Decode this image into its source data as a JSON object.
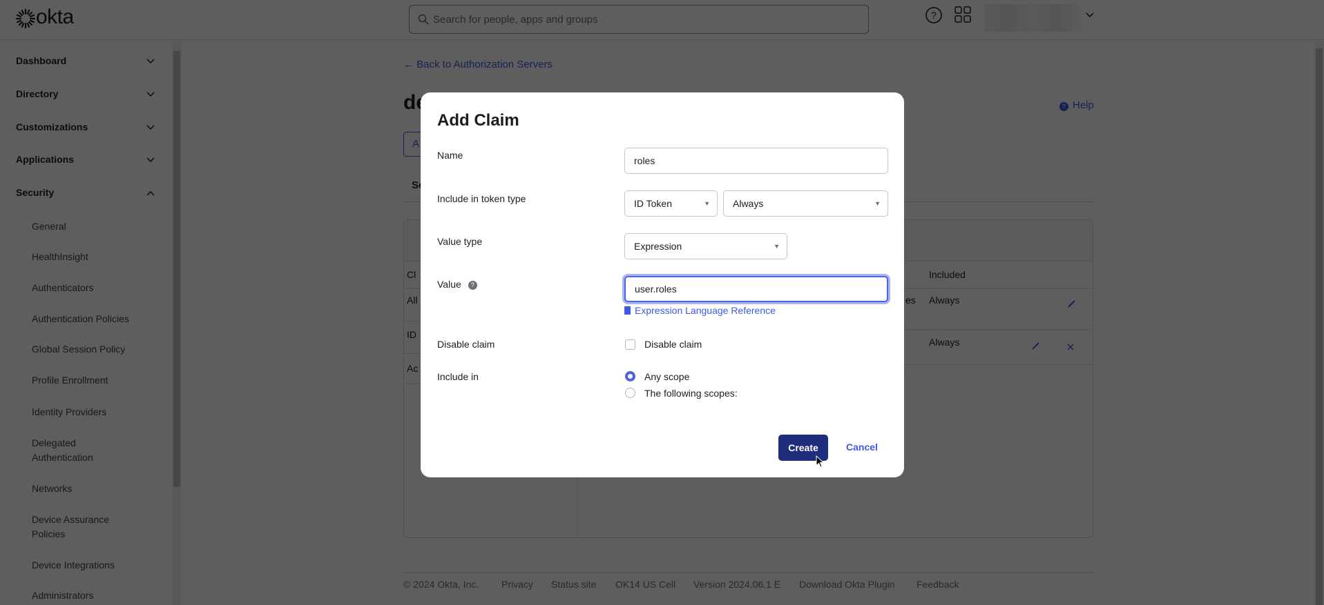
{
  "header": {
    "brand": "okta",
    "search_placeholder": "Search for people, apps and groups"
  },
  "sidebar": {
    "top_items": [
      {
        "label": "Dashboard",
        "expanded": false
      },
      {
        "label": "Directory",
        "expanded": false
      },
      {
        "label": "Customizations",
        "expanded": false
      },
      {
        "label": "Applications",
        "expanded": false
      },
      {
        "label": "Security",
        "expanded": true
      }
    ],
    "security_items": [
      "General",
      "HealthInsight",
      "Authenticators",
      "Authentication Policies",
      "Global Session Policy",
      "Profile Enrollment",
      "Identity Providers",
      "Delegated Authentication",
      "Networks",
      "Device Assurance Policies",
      "Device Integrations",
      "Administrators"
    ]
  },
  "page": {
    "back_link": "← Back to Authorization Servers",
    "title_fragment": "de",
    "help": "Help",
    "button_fragment": "A",
    "tab_fragment": "Se",
    "table": {
      "left_header_fragment": "Cl",
      "left_rows": [
        "All",
        "ID",
        "Ac"
      ],
      "right_header": "Included",
      "right_rows": [
        {
          "fragment": "es",
          "included": "Always"
        },
        {
          "fragment": "",
          "included": "Always"
        }
      ]
    }
  },
  "footer": [
    "© 2024 Okta, Inc.",
    "Privacy",
    "Status site",
    "OK14 US Cell",
    "Version 2024.06.1 E",
    "Download Okta Plugin",
    "Feedback"
  ],
  "modal": {
    "title": "Add Claim",
    "name_label": "Name",
    "name_value": "roles",
    "token_label": "Include in token type",
    "token_type": "ID Token",
    "token_when": "Always",
    "value_type_label": "Value type",
    "value_type": "Expression",
    "value_label": "Value",
    "value": "user.roles",
    "expr_link": "Expression Language Reference",
    "disable_label": "Disable claim",
    "disable_checkbox_label": "Disable claim",
    "disable_checked": false,
    "include_label": "Include in",
    "scope_options": [
      {
        "label": "Any scope",
        "selected": true
      },
      {
        "label": "The following scopes:",
        "selected": false
      }
    ],
    "create": "Create",
    "cancel": "Cancel"
  },
  "colors": {
    "accent": "#3f59e4",
    "primary_button": "#1f2d7d"
  }
}
